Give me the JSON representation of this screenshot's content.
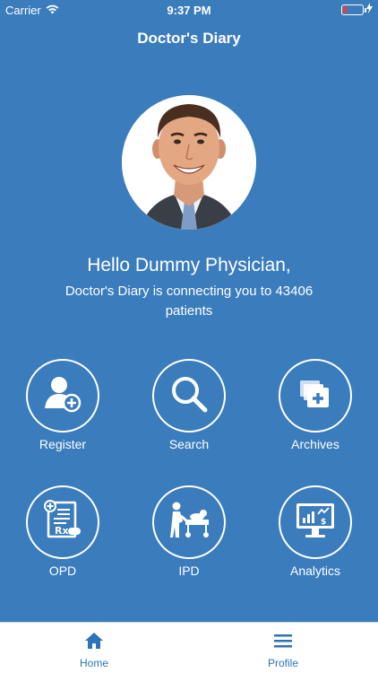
{
  "status_bar": {
    "carrier": "Carrier",
    "time": "9:37 PM",
    "battery_color": "#e5413a"
  },
  "nav": {
    "title": "Doctor's Diary"
  },
  "profile": {
    "greeting": "Hello Dummy Physician,",
    "subtitle": "Doctor's Diary is connecting you to 43406 patients"
  },
  "menu": {
    "items": [
      {
        "label": "Register",
        "icon": "add-user-icon"
      },
      {
        "label": "Search",
        "icon": "search-icon"
      },
      {
        "label": "Archives",
        "icon": "archive-folders-icon"
      },
      {
        "label": "OPD",
        "icon": "prescription-icon"
      },
      {
        "label": "IPD",
        "icon": "stretcher-icon"
      },
      {
        "label": "Analytics",
        "icon": "analytics-monitor-icon"
      }
    ]
  },
  "tab_bar": {
    "items": [
      {
        "label": "Home",
        "icon": "home-icon"
      },
      {
        "label": "Profile",
        "icon": "menu-icon"
      }
    ]
  },
  "colors": {
    "background": "#3b7cbd",
    "accent": "#2c73b7",
    "text": "#ffffff"
  }
}
